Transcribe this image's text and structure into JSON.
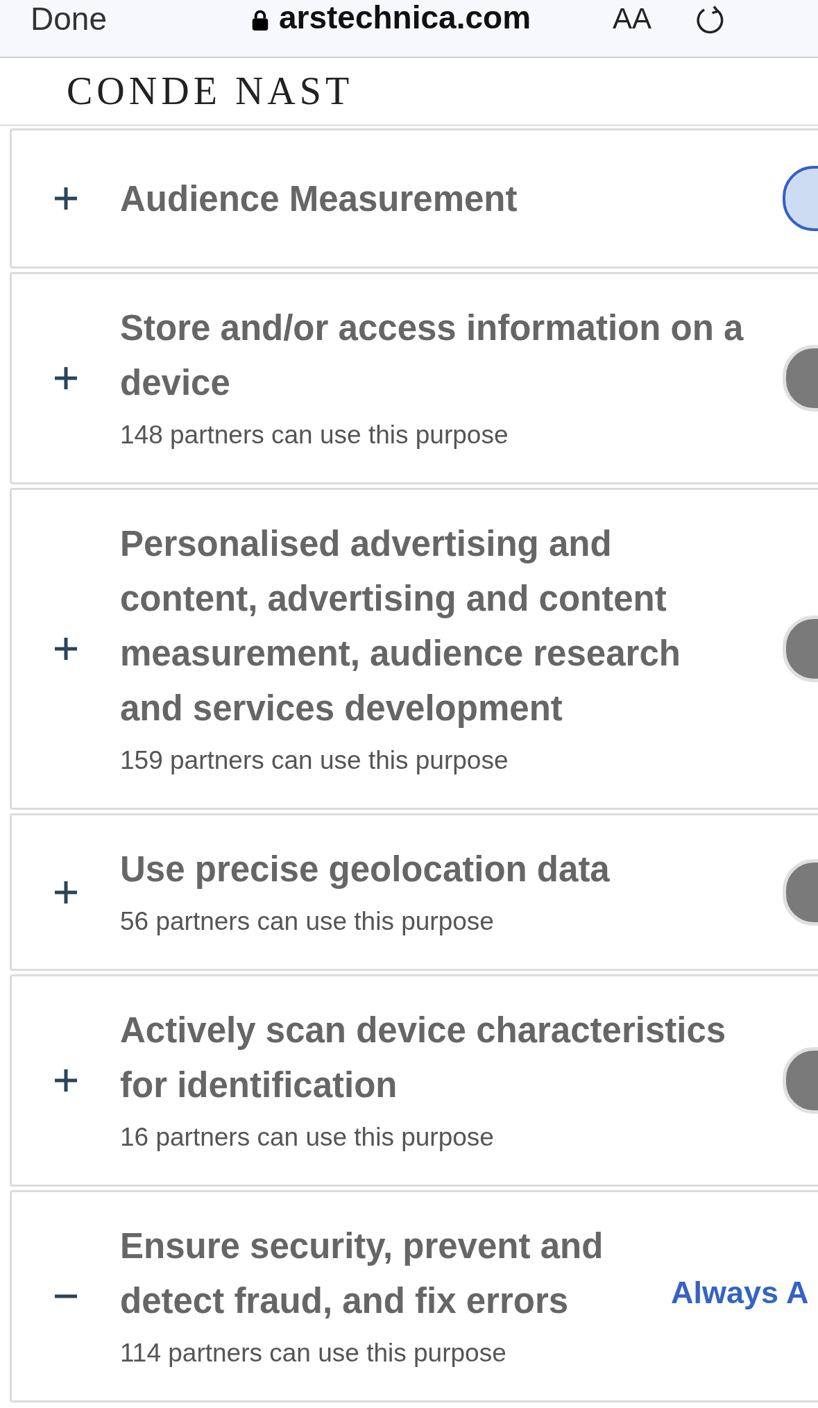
{
  "browser_bar": {
    "done": "Done",
    "url": "arstechnica.com",
    "text_size": "AA"
  },
  "logo": "CONDE NAST",
  "purposes": [
    {
      "title": "Audience Measurement",
      "kind": "toggle",
      "on": true,
      "expanded": false
    },
    {
      "title": "Store and/or access information on a device",
      "partners": "148 partners can use this purpose",
      "kind": "toggle",
      "on": false,
      "expanded": false
    },
    {
      "title": "Personalised advertising and content, advertising and content measurement, audience research and services development",
      "partners": "159 partners can use this purpose",
      "kind": "toggle",
      "on": false,
      "expanded": false
    },
    {
      "title": "Use precise geolocation data",
      "partners": "56 partners can use this purpose",
      "kind": "toggle",
      "on": false,
      "expanded": false
    },
    {
      "title": "Actively scan device characteristics for identification",
      "partners": "16 partners can use this purpose",
      "kind": "toggle",
      "on": false,
      "expanded": false
    },
    {
      "title": "Ensure security, prevent and detect fraud, and fix errors",
      "partners": "114 partners can use this purpose",
      "kind": "always",
      "status": "Always A",
      "expanded": true
    }
  ]
}
